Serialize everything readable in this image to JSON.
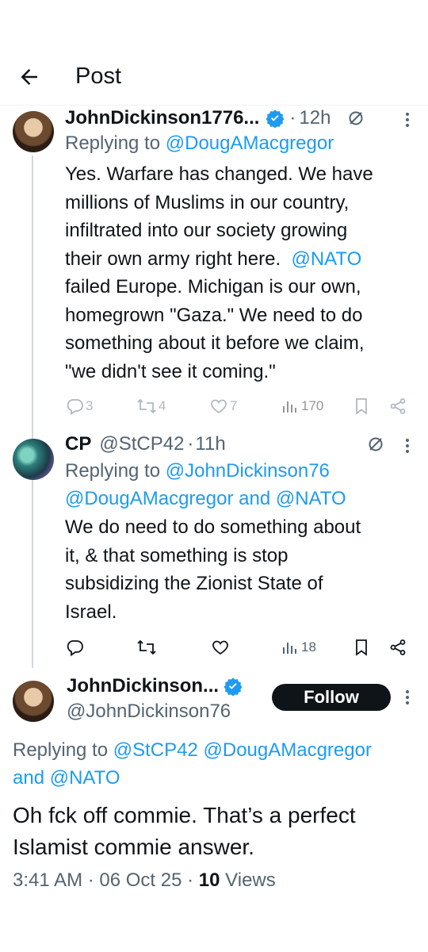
{
  "header": {
    "title": "Post"
  },
  "colors": {
    "accent": "#1d9bf0",
    "muted": "#536471",
    "text": "#0f1419",
    "follow_bg": "#0f1419"
  },
  "tweets": [
    {
      "name": "JohnDickinson1776...",
      "sep": "·",
      "time": "12h",
      "replying_prefix": "Replying to",
      "replying_to": "@DougAMacgregor",
      "body": {
        "line1": "Yes.  Warfare has changed.  We have",
        "line2": "millions of Muslims in our country,",
        "line3": "infiltrated into our society growing",
        "line4a": "their own army right here.",
        "line4_mention": "@NATO",
        "line5": "failed Europe.  Michigan is our own,",
        "line6": "homegrown \"Gaza.\"  We need to do",
        "line7": "something about it before we claim,",
        "line8": "\"we didn't see it coming.\""
      },
      "stats": {
        "replies": "3",
        "reposts": "4",
        "likes": "7",
        "views": "170"
      }
    },
    {
      "name": "CP",
      "handle": "@StCP42",
      "sep": "·",
      "time": "11h",
      "replying_prefix": "Replying to",
      "replying_to_1": "@JohnDickinson76",
      "replying_to_2": "@DougAMacgregor",
      "replying_and": "and",
      "replying_to_3": "@NATO",
      "body": {
        "line1": "We do need to do something about",
        "line2": "it, & that something is stop",
        "line3": "subsidizing the Zionist State of",
        "line4": "Israel."
      },
      "stats": {
        "views": "18"
      }
    }
  ],
  "main_post": {
    "name": "JohnDickinson...",
    "handle": "@JohnDickinson76",
    "follow_label": "Follow",
    "replying_prefix": "Replying to",
    "replying_to_1": "@StCP42",
    "replying_to_2": "@DougAMacgregor",
    "replying_and": "and",
    "replying_to_3": "@NATO",
    "body_line1": "Oh fck off commie.  That’s a perfect",
    "body_line2": "Islamist commie answer.",
    "timestamp": "3:41 AM · 06 Oct 25 · ",
    "views_count": "10",
    "views_label": "Views"
  }
}
